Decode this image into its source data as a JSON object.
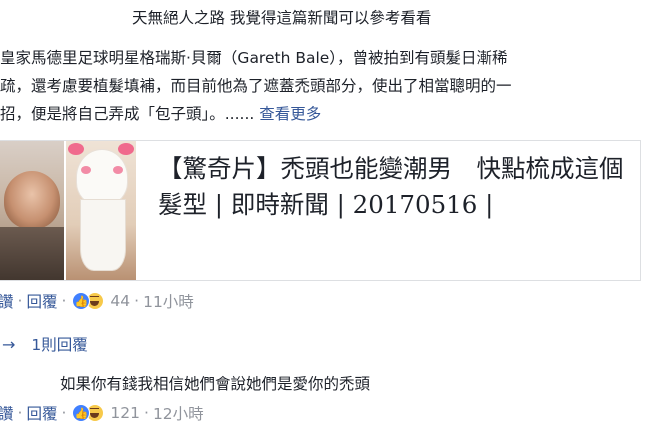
{
  "top_line": "天無絕人之路 我覺得這篇新聞可以參考看看",
  "post": {
    "line1": "皇家馬德里足球明星格瑞斯‧貝爾（Gareth Bale），曾被拍到有頭髮日漸稀",
    "line2": "疏，還考慮要植髮填補，而目前他為了遮蓋禿頭部分，使出了相當聰明的一",
    "line3": "招，便是將自己弄成「包子頭」。......",
    "see_more": "查看更多"
  },
  "link_card": {
    "title": "【驚奇片】禿頭也能變潮男　快點梳成這個髮型 | 即時新聞 | 20170516 |"
  },
  "comment1_actions": {
    "like": "讚",
    "dot1": "·",
    "reply": "回覆",
    "dot2": "·",
    "count": "44",
    "dot3": "·",
    "time": "11小時"
  },
  "replies_link": {
    "arrow": "→",
    "label": "1則回覆"
  },
  "comment2": {
    "text": "如果你有錢我相信她們會說她們是愛你的禿頭"
  },
  "comment2_actions": {
    "like": "讚",
    "dot1": "·",
    "reply": "回覆",
    "dot2": "·",
    "count": "121",
    "dot3": "·",
    "time": "12小時"
  },
  "icons": {
    "like_reaction": "thumbs-up-icon",
    "haha_reaction": "haha-face-icon",
    "like_color": "#4080ff",
    "haha_color": "#f7c94a",
    "link_color": "#365899"
  }
}
